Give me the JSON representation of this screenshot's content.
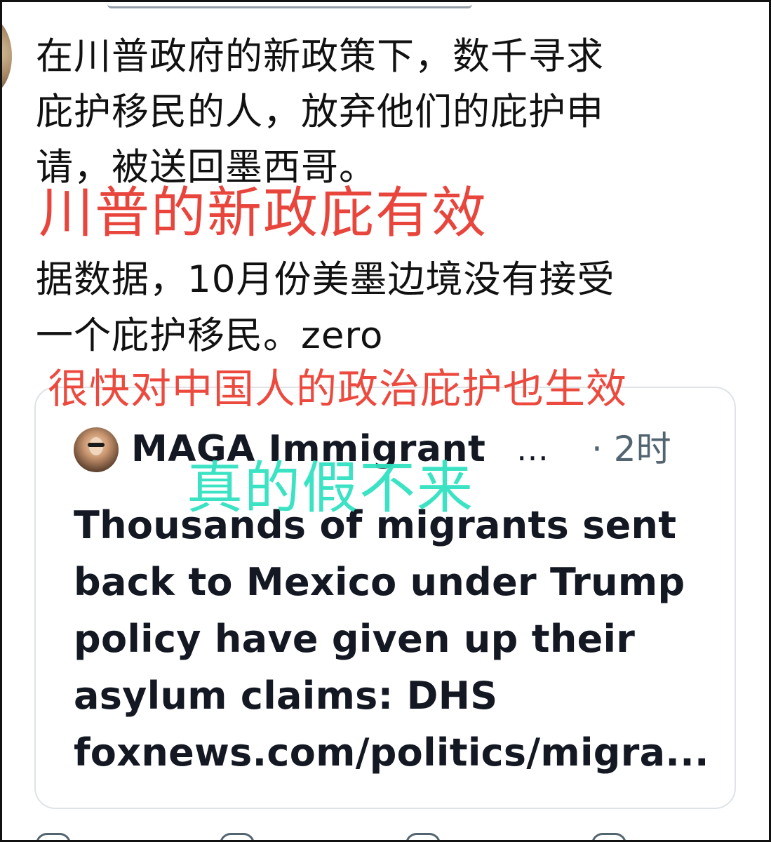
{
  "tweet": {
    "text_lines": [
      "在川普政府的新政策下，数千寻求",
      "庇护移民的人，放弃他们的庇护申",
      "请，被送回墨西哥。"
    ],
    "text_lines_2": [
      "据数据，10月份美墨边境没有接受",
      "一个庇护移民。zero"
    ]
  },
  "annotations": {
    "red_1": "川普的新政庇有效",
    "red_2": "很快对中国人的政治庇护也生效",
    "teal": "真的假不来"
  },
  "quoted_tweet": {
    "author": "MAGA Immigrant",
    "ellipsis": "…",
    "time": "· 2时",
    "body_lines": [
      "Thousands of migrants sent",
      "back to Mexico under Trump",
      "policy have given up their",
      "asylum claims: DHS",
      "foxnews.com/politics/migra..."
    ]
  },
  "colors": {
    "annotation_red": "#e8453c",
    "annotation_teal": "#31e2c1",
    "card_border": "#dfe3e7",
    "muted_text": "#536471"
  }
}
